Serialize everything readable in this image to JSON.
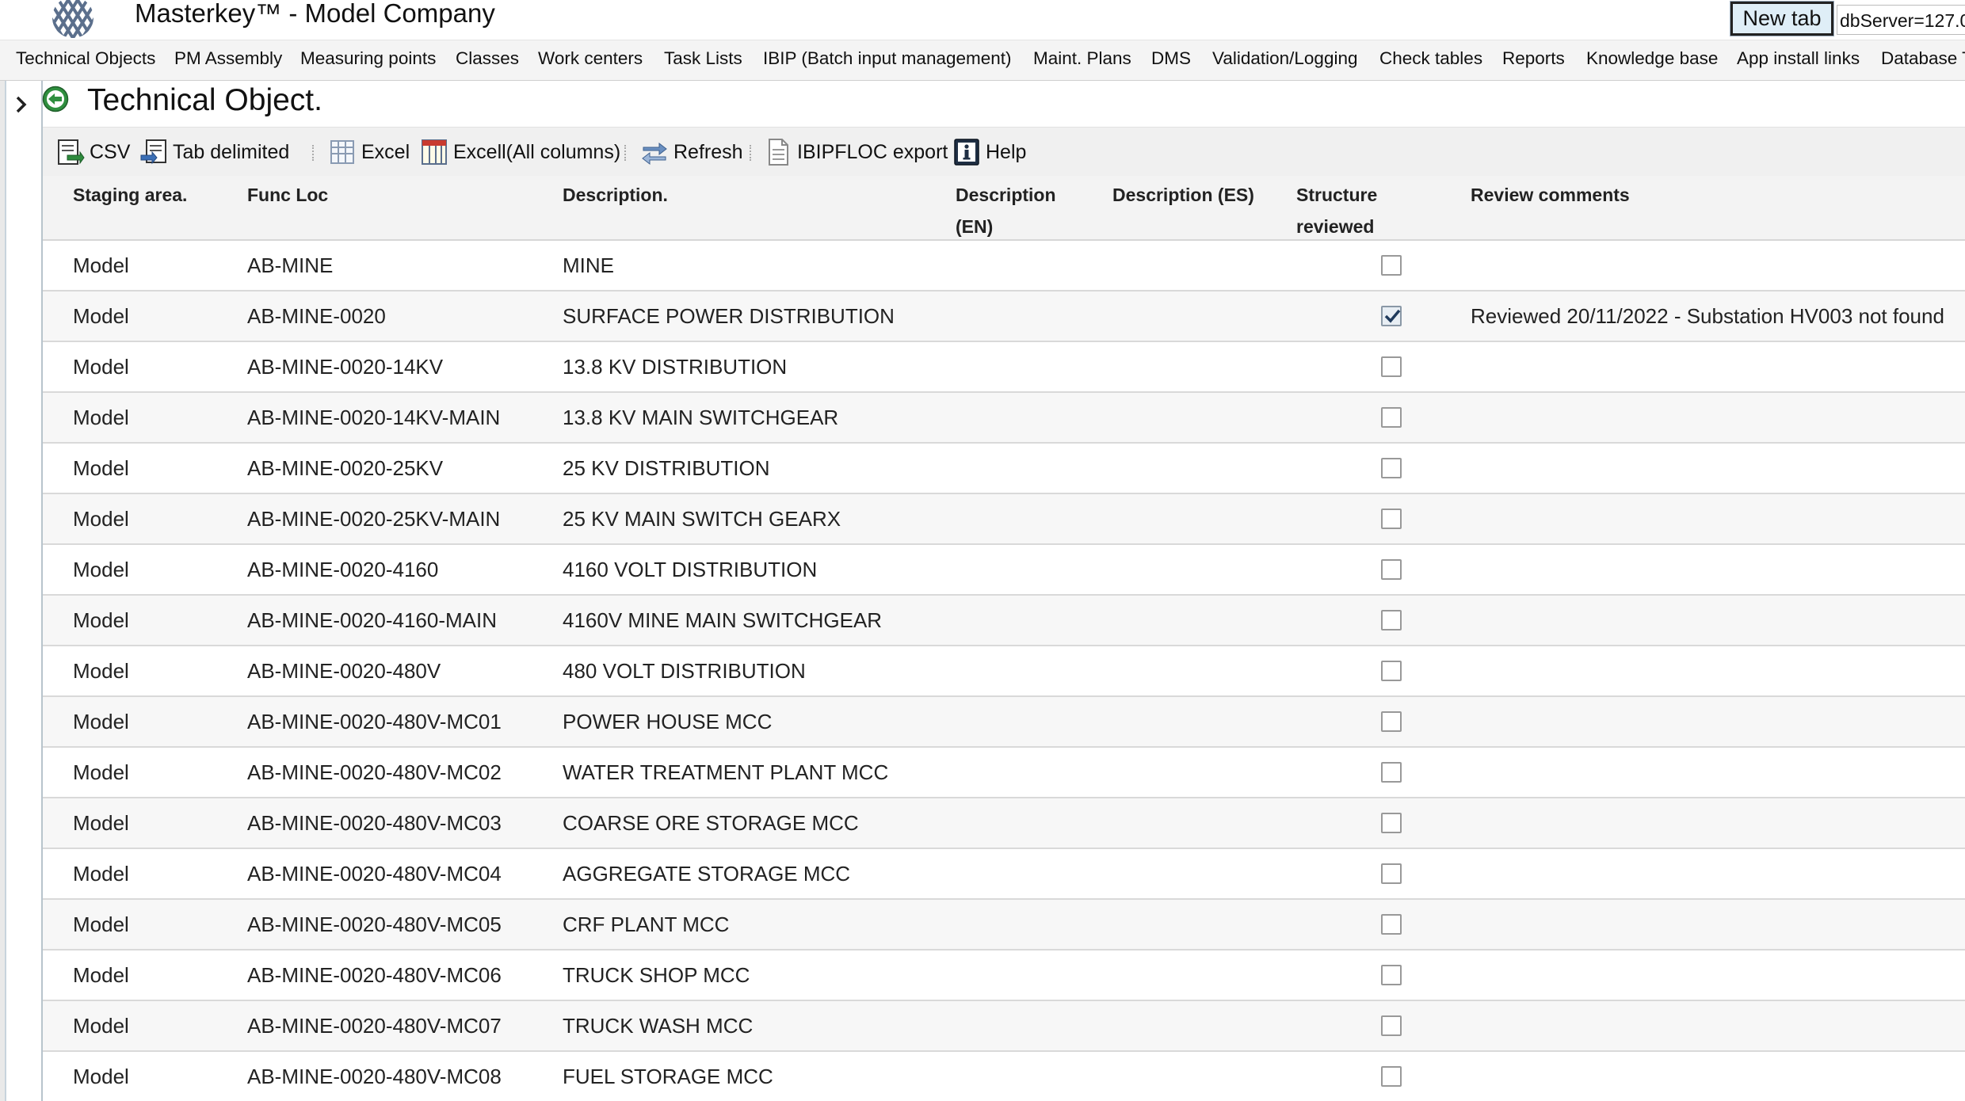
{
  "header": {
    "title": "Masterkey™ - Model Company",
    "new_tab_label": "New tab",
    "db_server": "dbServer=127.0."
  },
  "menu": [
    "Technical Objects",
    "PM Assembly",
    "Measuring points",
    "Classes",
    "Work centers",
    "Task Lists",
    "IBIP (Batch input management)",
    "Maint. Plans",
    "DMS",
    "Validation/Logging",
    "Check tables",
    "Reports",
    "Knowledge base",
    "App install links",
    "Database T"
  ],
  "page": {
    "title": "Technical Object."
  },
  "toolbar": {
    "csv": "CSV",
    "tab_delimited": "Tab delimited",
    "excel": "Excel",
    "excel_all": "Excell(All columns)",
    "refresh": "Refresh",
    "ibipfloc_export": "IBIPFLOC export",
    "help": "Help"
  },
  "columns": {
    "staging": "Staging area.",
    "func_loc": "Func Loc",
    "description": "Description.",
    "description_en_1": "Description",
    "description_en_2": "(EN)",
    "description_es": "Description (ES)",
    "structure_reviewed_1": "Structure",
    "structure_reviewed_2": "reviewed",
    "review_comments": "Review comments"
  },
  "rows": [
    {
      "staging": "Model",
      "func_loc": "AB-MINE",
      "description": "MINE",
      "reviewed": false,
      "comment": ""
    },
    {
      "staging": "Model",
      "func_loc": "AB-MINE-0020",
      "description": "SURFACE POWER DISTRIBUTION",
      "reviewed": true,
      "comment": "Reviewed 20/11/2022 - Substation HV003 not found"
    },
    {
      "staging": "Model",
      "func_loc": "AB-MINE-0020-14KV",
      "description": "13.8 KV DISTRIBUTION",
      "reviewed": false,
      "comment": ""
    },
    {
      "staging": "Model",
      "func_loc": "AB-MINE-0020-14KV-MAIN",
      "description": "13.8 KV MAIN SWITCHGEAR",
      "reviewed": false,
      "comment": ""
    },
    {
      "staging": "Model",
      "func_loc": "AB-MINE-0020-25KV",
      "description": "25 KV DISTRIBUTION",
      "reviewed": false,
      "comment": ""
    },
    {
      "staging": "Model",
      "func_loc": "AB-MINE-0020-25KV-MAIN",
      "description": "25 KV MAIN SWITCH GEARX",
      "reviewed": false,
      "comment": ""
    },
    {
      "staging": "Model",
      "func_loc": "AB-MINE-0020-4160",
      "description": "4160 VOLT DISTRIBUTION",
      "reviewed": false,
      "comment": ""
    },
    {
      "staging": "Model",
      "func_loc": "AB-MINE-0020-4160-MAIN",
      "description": "4160V MINE MAIN SWITCHGEAR",
      "reviewed": false,
      "comment": ""
    },
    {
      "staging": "Model",
      "func_loc": "AB-MINE-0020-480V",
      "description": "480 VOLT DISTRIBUTION",
      "reviewed": false,
      "comment": ""
    },
    {
      "staging": "Model",
      "func_loc": "AB-MINE-0020-480V-MC01",
      "description": "POWER HOUSE MCC",
      "reviewed": false,
      "comment": ""
    },
    {
      "staging": "Model",
      "func_loc": "AB-MINE-0020-480V-MC02",
      "description": "WATER TREATMENT PLANT MCC",
      "reviewed": false,
      "comment": ""
    },
    {
      "staging": "Model",
      "func_loc": "AB-MINE-0020-480V-MC03",
      "description": "COARSE ORE STORAGE MCC",
      "reviewed": false,
      "comment": ""
    },
    {
      "staging": "Model",
      "func_loc": "AB-MINE-0020-480V-MC04",
      "description": "AGGREGATE STORAGE MCC",
      "reviewed": false,
      "comment": ""
    },
    {
      "staging": "Model",
      "func_loc": "AB-MINE-0020-480V-MC05",
      "description": "CRF PLANT MCC",
      "reviewed": false,
      "comment": ""
    },
    {
      "staging": "Model",
      "func_loc": "AB-MINE-0020-480V-MC06",
      "description": "TRUCK SHOP MCC",
      "reviewed": false,
      "comment": ""
    },
    {
      "staging": "Model",
      "func_loc": "AB-MINE-0020-480V-MC07",
      "description": "TRUCK WASH MCC",
      "reviewed": false,
      "comment": ""
    },
    {
      "staging": "Model",
      "func_loc": "AB-MINE-0020-480V-MC08",
      "description": "FUEL STORAGE MCC",
      "reviewed": false,
      "comment": ""
    }
  ]
}
